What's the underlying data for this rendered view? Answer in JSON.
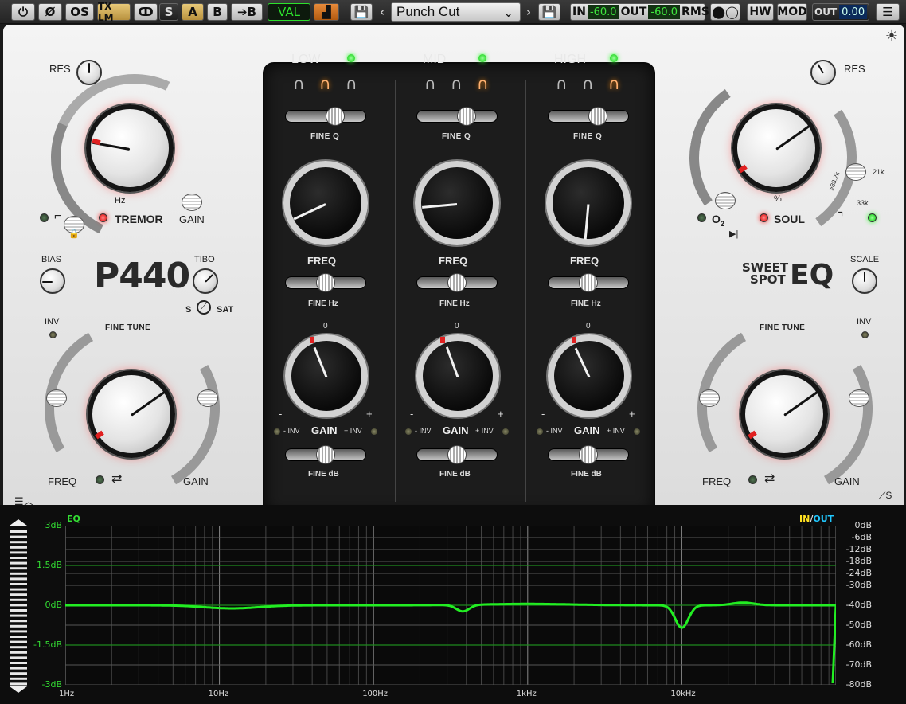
{
  "toolbar": {
    "os": "OS",
    "txlm": "TX LM",
    "s": "S",
    "a": "A",
    "b": "B",
    "to_b": "➔B",
    "val": "VAL",
    "preset": "Punch Cut",
    "in_label": "IN",
    "in_value": "-60.0",
    "out_label": "OUT",
    "out_value": "-60.0",
    "rms": "RMS",
    "hw": "HW",
    "mod": "MOD",
    "out2_label": "OUT",
    "out2_value": "0.00",
    "menu": "☰"
  },
  "left": {
    "res": "RES",
    "tremor": "TREMOR",
    "gain": "GAIN",
    "hz": "Hz",
    "bias": "BIAS",
    "title": "P440",
    "tibo": "TIBO",
    "s": "S",
    "sat": "SAT",
    "inv": "INV",
    "fine_tune": "FINE TUNE",
    "freq": "FREQ",
    "gain2": "GAIN"
  },
  "center": {
    "bands": [
      {
        "name": "LOW",
        "fine_q": "FINE Q",
        "freq": "FREQ",
        "fine_hz": "FINE Hz",
        "gain": "GAIN",
        "fine_db": "FINE dB",
        "minus_inv": "- INV",
        "plus_inv": "+ INV",
        "zero": "0",
        "minus": "-",
        "plus": "+"
      },
      {
        "name": "MID",
        "fine_q": "FINE Q",
        "freq": "FREQ",
        "fine_hz": "FINE Hz",
        "gain": "GAIN",
        "fine_db": "FINE dB",
        "minus_inv": "- INV",
        "plus_inv": "+ INV",
        "zero": "0",
        "minus": "-",
        "plus": "+"
      },
      {
        "name": "HIGH",
        "fine_q": "FINE Q",
        "freq": "FREQ",
        "fine_hz": "FINE Hz",
        "gain": "GAIN",
        "fine_db": "FINE dB",
        "minus_inv": "- INV",
        "plus_inv": "+ INV",
        "zero": "0",
        "minus": "-",
        "plus": "+"
      }
    ]
  },
  "right": {
    "res": "RES",
    "soul": "SOUL",
    "o2": "O",
    "o2_sub": "2",
    "pct": "%",
    "k21": "21k",
    "k33": "33k",
    "k88": "≥88.2k",
    "logo_line1": "SWEET",
    "logo_line2": "SPOT",
    "logo_eq": "EQ",
    "scale": "SCALE",
    "inv": "INV",
    "fine_tune": "FINE TUNE",
    "freq": "FREQ",
    "gain": "GAIN"
  },
  "analyzer": {
    "eq_label": "EQ",
    "in": "IN",
    "slash": "/",
    "out": "OUT",
    "left_axis": [
      "3dB",
      "1.5dB",
      "0dB",
      "-1.5dB",
      "-3dB"
    ],
    "right_axis": [
      "0dB",
      "-6dB",
      "-12dB",
      "-18dB",
      "-24dB",
      "-30dB",
      "-40dB",
      "-50dB",
      "-60dB",
      "-70dB",
      "-80dB"
    ],
    "x_axis": [
      "1Hz",
      "10Hz",
      "100Hz",
      "1kHz",
      "10kHz"
    ]
  },
  "colors": {
    "accent_green": "#22ee22",
    "led_red": "#ee2222",
    "in_yellow": "#ffe020",
    "out_cyan": "#20c8ff"
  }
}
